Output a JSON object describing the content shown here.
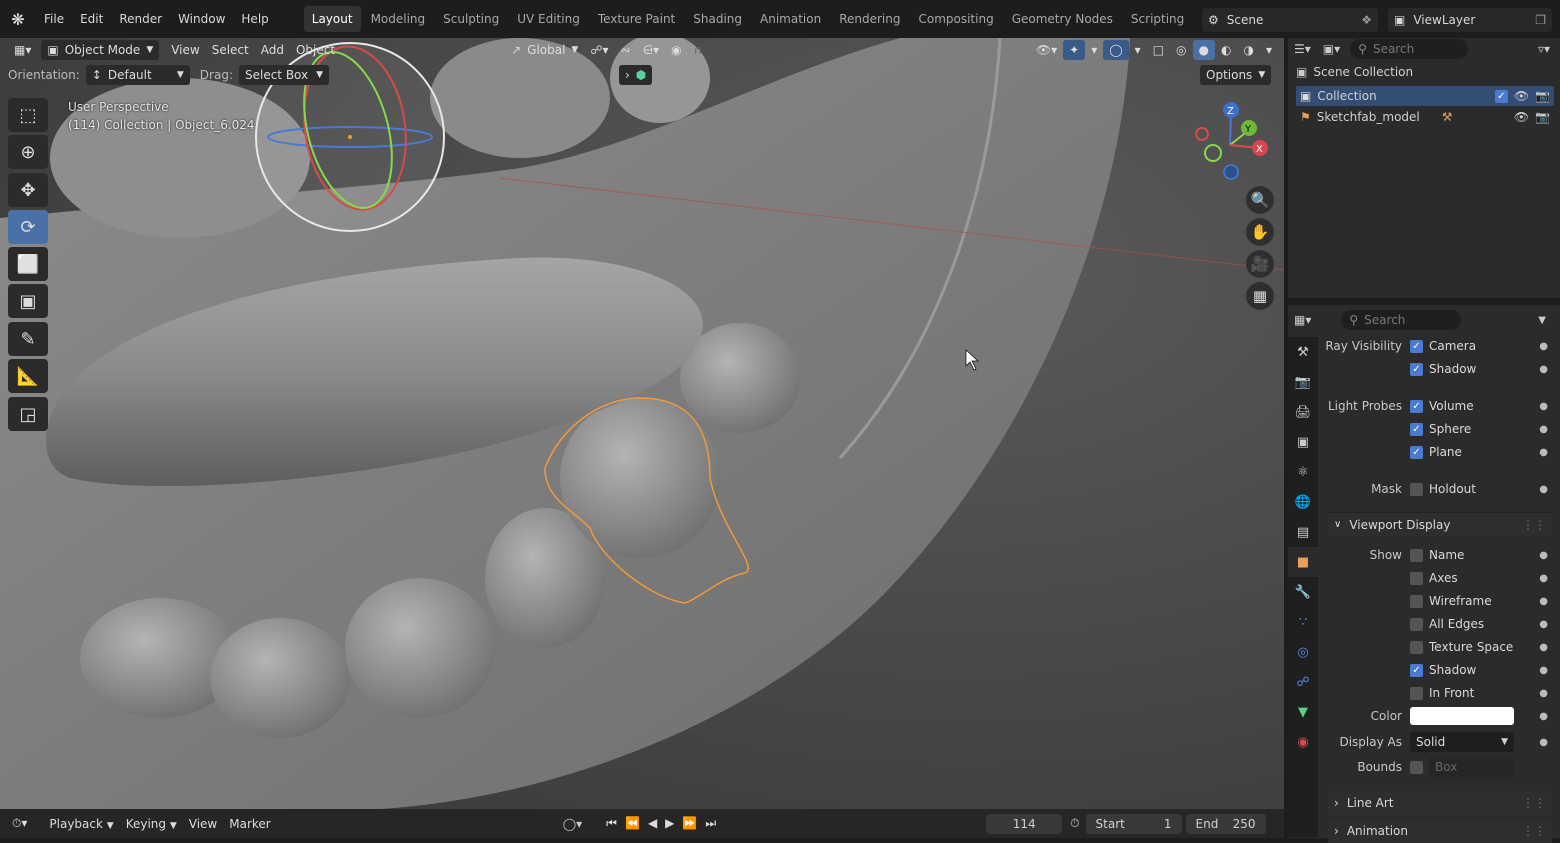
{
  "menus": [
    "File",
    "Edit",
    "Render",
    "Window",
    "Help"
  ],
  "workspace_tabs": [
    {
      "label": "Layout",
      "active": true
    },
    {
      "label": "Modeling",
      "active": false
    },
    {
      "label": "Sculpting",
      "active": false
    },
    {
      "label": "UV Editing",
      "active": false
    },
    {
      "label": "Texture Paint",
      "active": false
    },
    {
      "label": "Shading",
      "active": false
    },
    {
      "label": "Animation",
      "active": false
    },
    {
      "label": "Rendering",
      "active": false
    },
    {
      "label": "Compositing",
      "active": false
    },
    {
      "label": "Geometry Nodes",
      "active": false
    },
    {
      "label": "Scripting",
      "active": false
    }
  ],
  "scene": {
    "label": "Scene"
  },
  "view_layer": {
    "label": "ViewLayer"
  },
  "viewport_header": {
    "mode": "Object Mode",
    "view": "View",
    "select": "Select",
    "add": "Add",
    "object": "Object",
    "transform": "Global"
  },
  "tool_settings": {
    "orientation_label": "Orientation:",
    "orientation_value": "Default",
    "drag_label": "Drag:",
    "drag_value": "Select Box",
    "options": "Options"
  },
  "viewport_info": {
    "line1": "User Perspective",
    "line2": "(114) Collection | Object_6.024"
  },
  "gizmo_axes": {
    "x": "X",
    "y": "Y",
    "z": "Z"
  },
  "outliner": {
    "search_placeholder": "Search",
    "scene_collection": "Scene Collection",
    "items": [
      {
        "label": "Collection"
      },
      {
        "label": "Sketchfab_model"
      }
    ]
  },
  "properties": {
    "search_placeholder": "Search",
    "ray_visibility_label": "Ray Visibility",
    "camera": "Camera",
    "shadow": "Shadow",
    "light_probes_label": "Light Probes",
    "volume": "Volume",
    "sphere": "Sphere",
    "plane": "Plane",
    "mask_label": "Mask",
    "holdout": "Holdout",
    "viewport_display": "Viewport Display",
    "show_label": "Show",
    "name": "Name",
    "axes": "Axes",
    "wireframe": "Wireframe",
    "all_edges": "All Edges",
    "texture_space": "Texture Space",
    "shadow2": "Shadow",
    "in_front": "In Front",
    "color_label": "Color",
    "display_as_label": "Display As",
    "display_as_value": "Solid",
    "bounds_label": "Bounds",
    "bounds_value": "Box",
    "line_art": "Line Art",
    "animation": "Animation"
  },
  "timeline": {
    "playback": "Playback",
    "keying": "Keying",
    "view": "View",
    "marker": "Marker",
    "current_frame": "114",
    "start_label": "Start",
    "start": "1",
    "end_label": "End",
    "end": "250"
  }
}
